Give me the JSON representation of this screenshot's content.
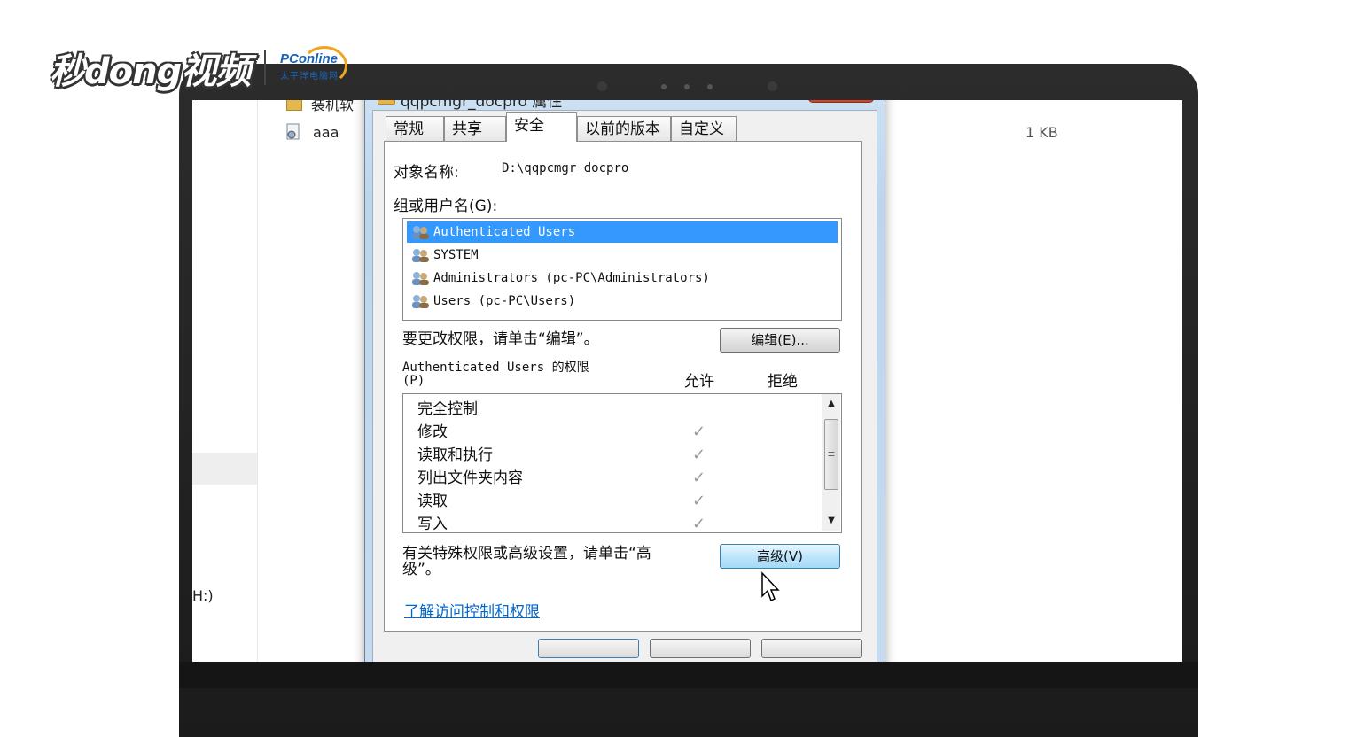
{
  "watermark": {
    "brand": "秒dong视频",
    "partner": "PConline",
    "partner_sub": "太平洋电脑网"
  },
  "explorer": {
    "partial_item_top": "装机软",
    "file_name": "aaa",
    "file_size": "1 KB",
    "drive_fragment": "H:)"
  },
  "dialog": {
    "title": "qqpcmgr_docpro 属性",
    "tabs": [
      "常规",
      "共享",
      "安全",
      "以前的版本",
      "自定义"
    ],
    "active_tab": "安全",
    "object_label": "对象名称:",
    "object_value": "D:\\qqpcmgr_docpro",
    "groups_label": "组或用户名(G):",
    "users": [
      {
        "name": "Authenticated Users",
        "selected": true
      },
      {
        "name": "SYSTEM",
        "selected": false
      },
      {
        "name": "Administrators (pc-PC\\Administrators)",
        "selected": false
      },
      {
        "name": "Users (pc-PC\\Users)",
        "selected": false
      }
    ],
    "change_hint": "要更改权限，请单击“编辑”。",
    "edit_button": "编辑(E)...",
    "perm_title_line1": "Authenticated Users 的权限",
    "perm_title_line2": "(P)",
    "allow_header": "允许",
    "deny_header": "拒绝",
    "permissions": [
      {
        "name": "完全控制",
        "allow": false
      },
      {
        "name": "修改",
        "allow": true
      },
      {
        "name": "读取和执行",
        "allow": true
      },
      {
        "name": "列出文件夹内容",
        "allow": true
      },
      {
        "name": "读取",
        "allow": true
      },
      {
        "name": "写入",
        "allow": true
      }
    ],
    "advanced_hint_line1": "有关特殊权限或高级设置，请单击“高",
    "advanced_hint_line2": "级”。",
    "advanced_button": "高级(V)",
    "learn_link": "了解访问控制和权限"
  }
}
